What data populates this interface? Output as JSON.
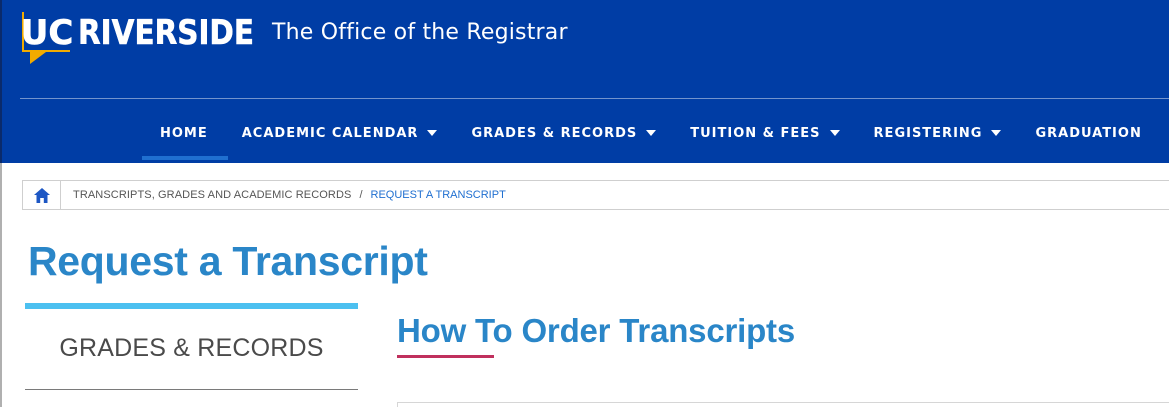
{
  "brand": {
    "logo_uc": "UC",
    "logo_name": "RIVERSIDE",
    "office_title": "The Office of the Registrar",
    "colors": {
      "navy": "#003da5",
      "gold": "#f1ab00",
      "link_blue": "#2a86c8",
      "accent_pink": "#c0305d",
      "sky": "#4cc0f0"
    }
  },
  "nav": {
    "items": [
      {
        "label": "HOME",
        "has_dropdown": false
      },
      {
        "label": "ACADEMIC CALENDAR",
        "has_dropdown": true
      },
      {
        "label": "GRADES & RECORDS",
        "has_dropdown": true
      },
      {
        "label": "TUITION & FEES",
        "has_dropdown": true
      },
      {
        "label": "REGISTERING",
        "has_dropdown": true
      },
      {
        "label": "GRADUATION",
        "has_dropdown": false
      }
    ]
  },
  "breadcrumb": {
    "home_icon": "home-icon",
    "parent": "TRANSCRIPTS, GRADES AND ACADEMIC RECORDS",
    "separator": "/",
    "current": "REQUEST A TRANSCRIPT"
  },
  "page": {
    "title": "Request a Transcript"
  },
  "sidebar": {
    "heading": "GRADES & RECORDS"
  },
  "main": {
    "heading": "How To Order Transcripts"
  }
}
